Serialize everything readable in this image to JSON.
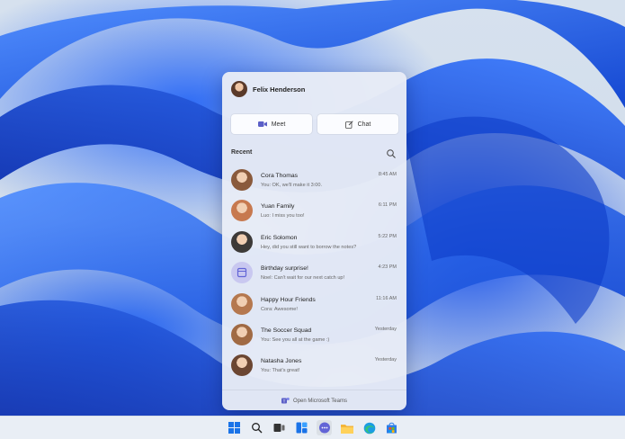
{
  "profile": {
    "name": "Felix Henderson"
  },
  "actions": {
    "meet_label": "Meet",
    "chat_label": "Chat"
  },
  "recent": {
    "label": "Recent",
    "items": [
      {
        "name": "Cora Thomas",
        "message": "You: OK, we'll make it 3:00.",
        "time": "8:45 AM",
        "avatar_color": "#8a5a3c"
      },
      {
        "name": "Yuan Family",
        "message": "Luo: I miss you too!",
        "time": "6:11 PM",
        "avatar_color": "#c7794f"
      },
      {
        "name": "Eric Solomon",
        "message": "Hey, did you still want to borrow the notes?",
        "time": "5:22 PM",
        "avatar_color": "#3d3a38"
      },
      {
        "name": "Birthday surprise!",
        "message": "Noel: Can't wait for our next catch up!",
        "time": "4:23 PM",
        "avatar_color": "#c9c8f0"
      },
      {
        "name": "Happy Hour Friends",
        "message": "Cora: Awesome!",
        "time": "11:16 AM",
        "avatar_color": "#b5784f"
      },
      {
        "name": "The Soccer Squad",
        "message": "You: See you all at the game :)",
        "time": "Yesterday",
        "avatar_color": "#a06a44"
      },
      {
        "name": "Natasha Jones",
        "message": "You: That's great!",
        "time": "Yesterday",
        "avatar_color": "#6b4632"
      }
    ]
  },
  "footer": {
    "label": "Open Microsoft Teams"
  },
  "colors": {
    "accent": "#5b5fc7",
    "taskbar": "#e9eef5"
  }
}
